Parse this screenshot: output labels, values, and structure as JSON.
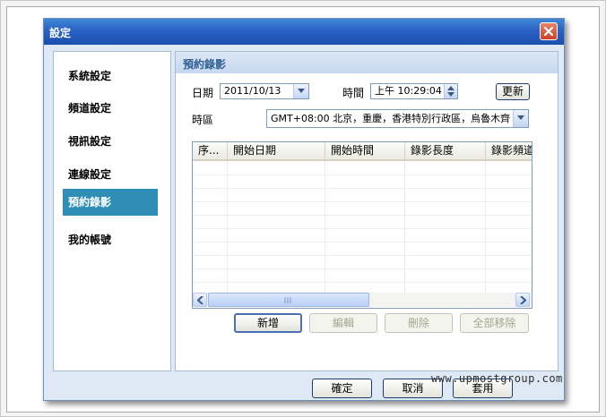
{
  "window": {
    "title": "設定"
  },
  "nav": {
    "items": [
      {
        "label": "系統設定"
      },
      {
        "label": "頻道設定"
      },
      {
        "label": "視訊設定"
      },
      {
        "label": "連線設定"
      },
      {
        "label": "預約錄影",
        "active": true
      },
      {
        "label": "我的帳號"
      }
    ]
  },
  "panel": {
    "title": "預約錄影",
    "date_label": "日期",
    "date_value": "2011/10/13",
    "time_label": "時間",
    "time_value": "上午 10:29:04",
    "refresh_label": "更新",
    "timezone_label": "時區",
    "timezone_value": "GMT+08:00 北京，重慶，香港特別行政區，烏魯木齊"
  },
  "table": {
    "columns": [
      "序...",
      "開始日期",
      "開始時間",
      "錄影長度",
      "錄影頻道"
    ],
    "rows": []
  },
  "actions": {
    "add": "新增",
    "edit": "編輯",
    "delete": "刪除",
    "delete_all": "全部移除"
  },
  "footer": {
    "ok": "確定",
    "cancel": "取消",
    "apply": "套用"
  },
  "watermark": "www.upmostgroup.com",
  "colors": {
    "titlebar": "#2a62c4",
    "nav_active": "#2f8eb5",
    "panel_title": "#2f5f93",
    "close_button": "#c9432a"
  }
}
